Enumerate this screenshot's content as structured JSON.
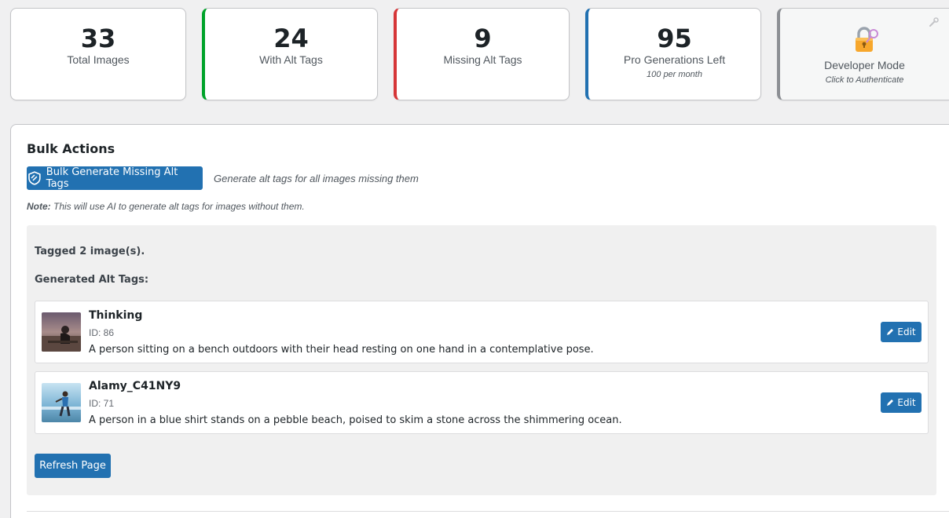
{
  "stats": [
    {
      "value": "33",
      "label": "Total Images"
    },
    {
      "value": "24",
      "label": "With Alt Tags"
    },
    {
      "value": "9",
      "label": "Missing Alt Tags"
    },
    {
      "value": "95",
      "label": "Pro Generations Left",
      "sub": "100 per month"
    }
  ],
  "developer": {
    "label": "Developer Mode",
    "sub": "Click to Authenticate",
    "icon": "lock-icon"
  },
  "colors": {
    "primary": "#2271b1",
    "success": "#00a32a",
    "danger": "#d63638",
    "neutral": "#8c8f94"
  },
  "bulk": {
    "title": "Bulk Actions",
    "button_label": "Bulk Generate Missing Alt Tags",
    "hint": "Generate alt tags for all images missing them",
    "note_label": "Note:",
    "note_text": " This will use AI to generate alt tags for images without them."
  },
  "results": {
    "tagged": "Tagged 2 image(s).",
    "generated_label": "Generated Alt Tags:",
    "items": [
      {
        "title": "Thinking",
        "id": "ID: 86",
        "alt": "A person sitting on a bench outdoors with their head resting on one hand in a contemplative pose.",
        "edit_label": "Edit"
      },
      {
        "title": "Alamy_C41NY9",
        "id": "ID: 71",
        "alt": "A person in a blue shirt stands on a pebble beach, poised to skim a stone across the shimmering ocean.",
        "edit_label": "Edit"
      }
    ],
    "refresh_label": "Refresh Page"
  }
}
